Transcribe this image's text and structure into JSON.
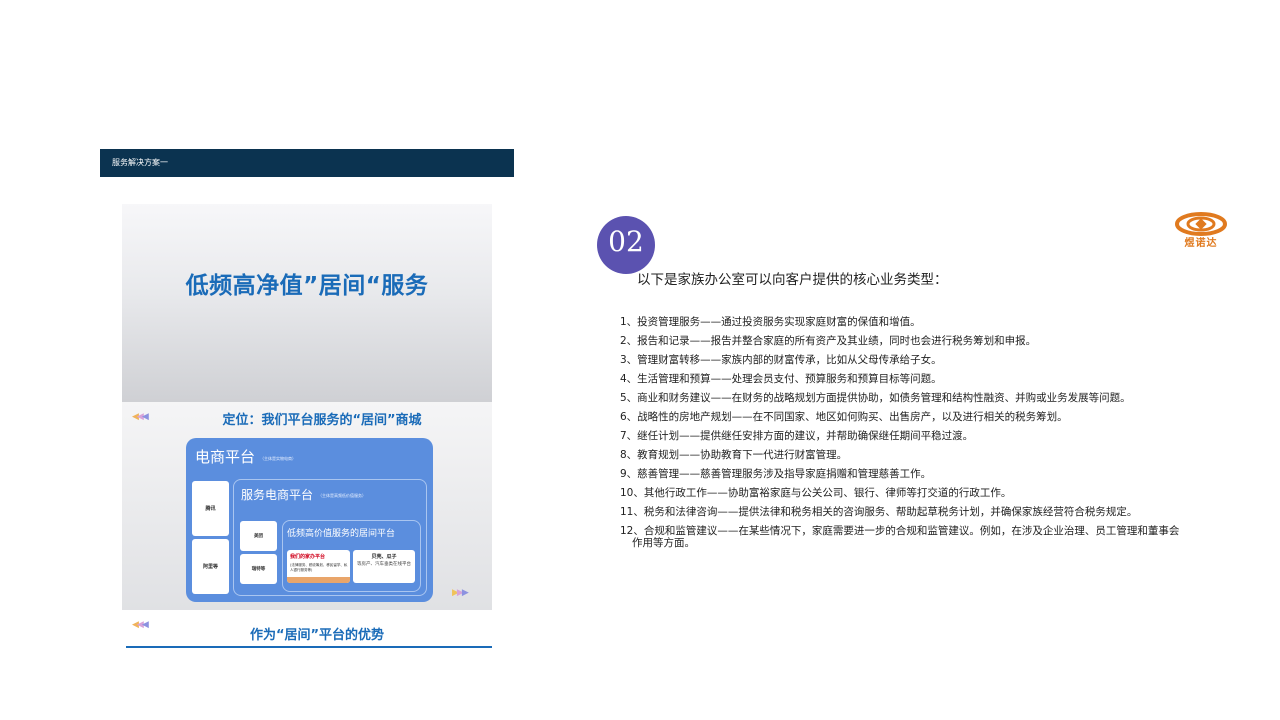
{
  "header": {
    "title": "服务解决方案一"
  },
  "slide": {
    "title": "低频高净值”居间“服务",
    "positioning": "定位：我们平台服务的“居间”商城",
    "ecommerce": {
      "title": "电商平台",
      "subtitle": "（主体是实物电商）"
    },
    "side_items": [
      "腾讯",
      "阿里等"
    ],
    "service_platform": {
      "title": "服务电商平台",
      "subtitle": "（主体是高频低价值服务）"
    },
    "mini_items": [
      "美团",
      "瑞特等"
    ],
    "high_value_platform": {
      "title": "低频高价值服务的居间平台"
    },
    "card_our": {
      "title": "我们的家办平台",
      "desc": "(法律服务、税收筹划、移民留学、私人银行服务等)"
    },
    "card_other": {
      "title": "贝壳、瓜子",
      "desc": "等房产、汽车垂类在线平台"
    },
    "advantage_title": "作为“居间”平台的优势"
  },
  "badge": {
    "number": "02"
  },
  "logo": {
    "name": "company-logo",
    "text": "煜诺达"
  },
  "intro": "以下是家族办公室可以向客户提供的核心业务类型：",
  "items": [
    "1、投资管理服务——通过投资服务实现家庭财富的保值和增值。",
    "2、报告和记录——报告并整合家庭的所有资产及其业绩，同时也会进行税务筹划和申报。",
    "3、管理财富转移——家族内部的财富传承，比如从父母传承给子女。",
    "4、生活管理和预算——处理会员支付、预算服务和预算目标等问题。",
    "5、商业和财务建议——在财务的战略规划方面提供协助，如债务管理和结构性融资、并购或业务发展等问题。",
    "6、战略性的房地产规划——在不同国家、地区如何购买、出售房产，以及进行相关的税务筹划。",
    "7、继任计划——提供继任安排方面的建议，并帮助确保继任期间平稳过渡。",
    "8、教育规划——协助教育下一代进行财富管理。",
    "9、慈善管理——慈善管理服务涉及指导家庭捐赠和管理慈善工作。",
    "10、其他行政工作——协助富裕家庭与公关公司、银行、律师等打交道的行政工作。",
    "11、税务和法律咨询——提供法律和税务相关的咨询服务、帮助起草税务计划，并确保家族经营符合税务规定。",
    "12、合规和监管建议——在某些情况下，家庭需要进一步的合规和监管建议。例如，在涉及企业治理、员工管理和董事会作用等方面。"
  ],
  "colors": {
    "navy": "#0b3350",
    "blue": "#1a6bb8",
    "purple": "#5b52b0",
    "orange": "#e07a1f"
  }
}
